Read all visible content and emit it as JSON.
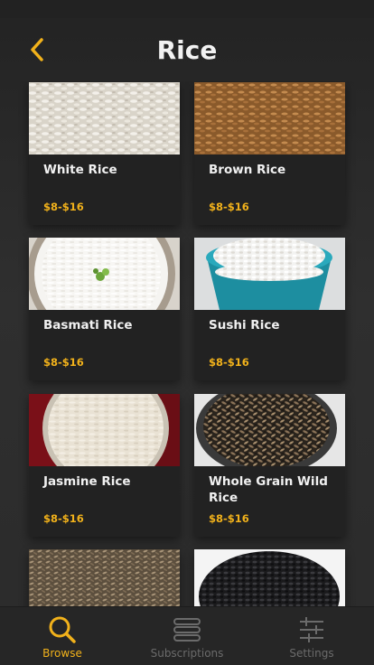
{
  "header": {
    "title": "Rice",
    "back_icon": "chevron-left-icon"
  },
  "colors": {
    "accent": "#f2b21b",
    "background": "#2b2b2b",
    "card": "#222222",
    "inactive_tab": "#6b6b6b"
  },
  "products": [
    {
      "name": "White Rice",
      "price": "$8-$16"
    },
    {
      "name": "Brown Rice",
      "price": "$8-$16"
    },
    {
      "name": "Basmati Rice",
      "price": "$8-$16"
    },
    {
      "name": "Sushi Rice",
      "price": "$8-$16"
    },
    {
      "name": "Jasmine Rice",
      "price": "$8-$16"
    },
    {
      "name": "Whole Grain Wild Rice",
      "price": "$8-$16"
    }
  ],
  "tab_bar": {
    "tabs": [
      {
        "label": "Browse",
        "icon": "search-icon",
        "active": true
      },
      {
        "label": "Subscriptions",
        "icon": "stack-icon",
        "active": false
      },
      {
        "label": "Settings",
        "icon": "sliders-icon",
        "active": false
      }
    ]
  }
}
